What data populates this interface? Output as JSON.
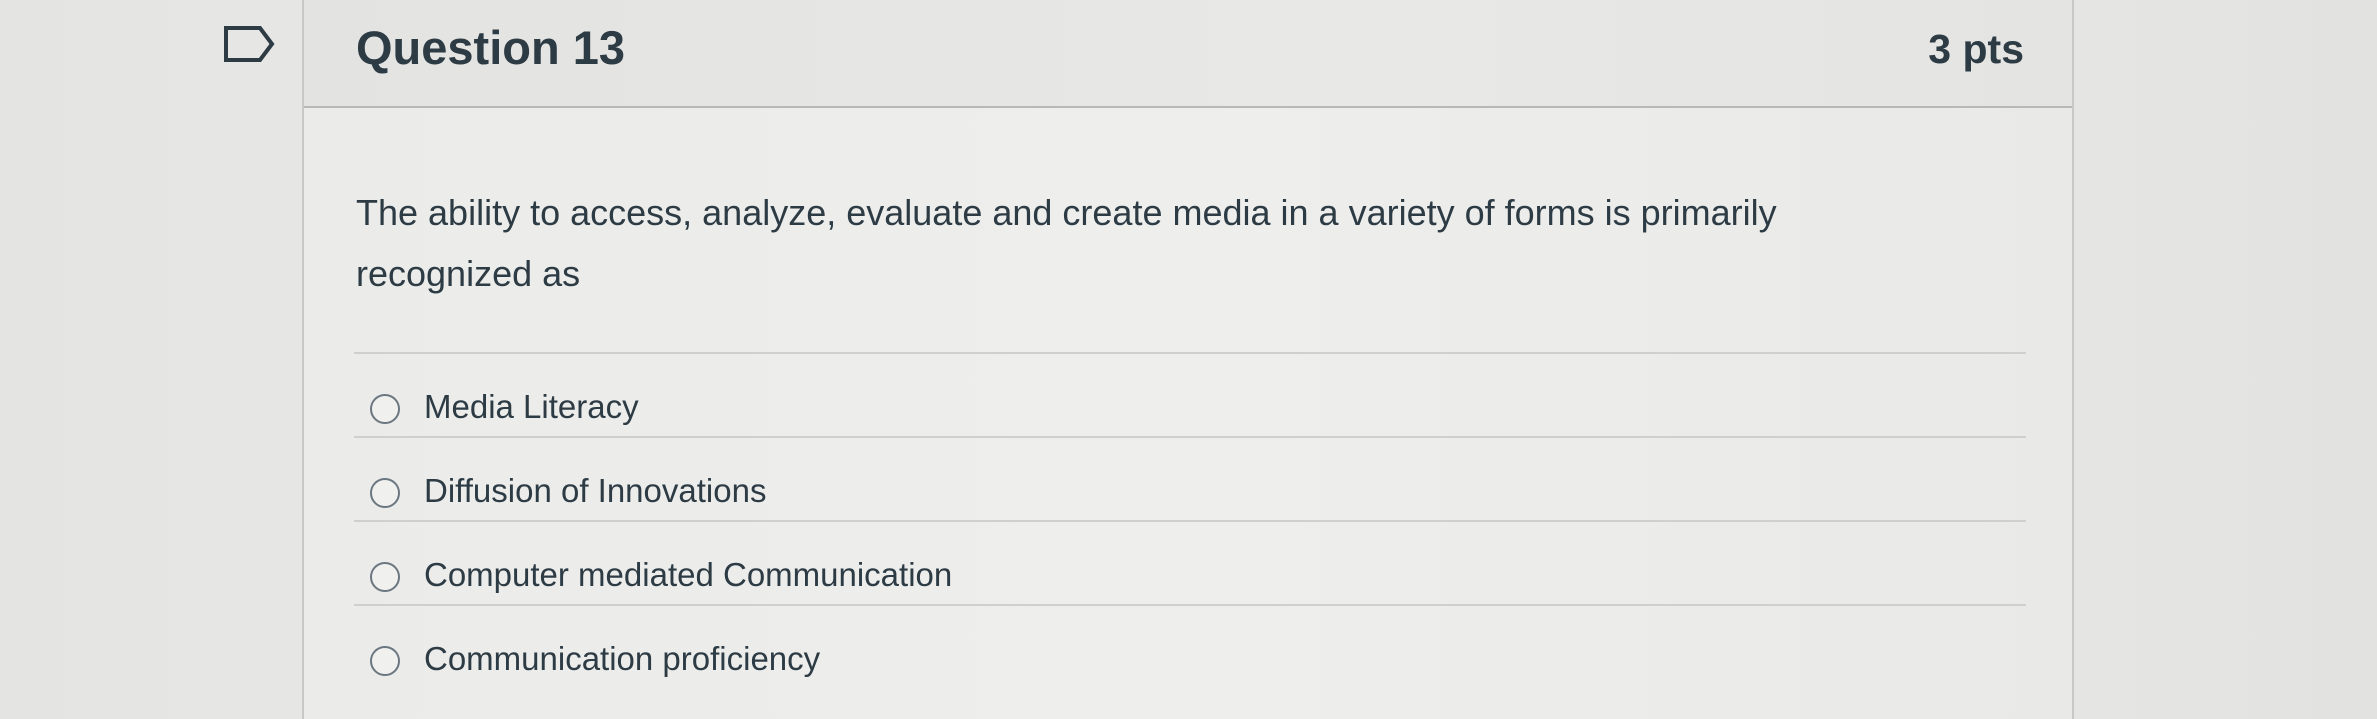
{
  "question": {
    "title": "Question 13",
    "points": "3 pts",
    "text": "The ability to access, analyze, evaluate and create media in a variety of forms is primarily recognized as"
  },
  "answers": [
    {
      "label": "Media Literacy"
    },
    {
      "label": "Diffusion of Innovations"
    },
    {
      "label": "Computer mediated Communication"
    },
    {
      "label": "Communication proficiency"
    }
  ],
  "icons": {
    "flag": "flag-bookmark-icon"
  },
  "colors": {
    "text": "#2d3b45",
    "border": "#c8c8c6"
  }
}
